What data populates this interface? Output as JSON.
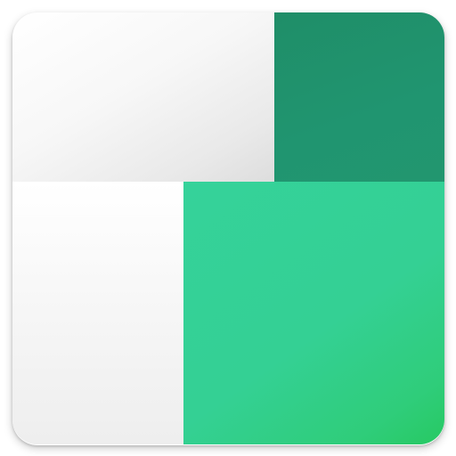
{
  "app_icon": {
    "icon_name": "four-tile-app-icon",
    "colors": {
      "light_tile": "#f5f5f5",
      "dark_green_tile": "#209570",
      "bright_green_tile": "#34d094",
      "bright_green_tile_corner": "#27c962"
    }
  }
}
